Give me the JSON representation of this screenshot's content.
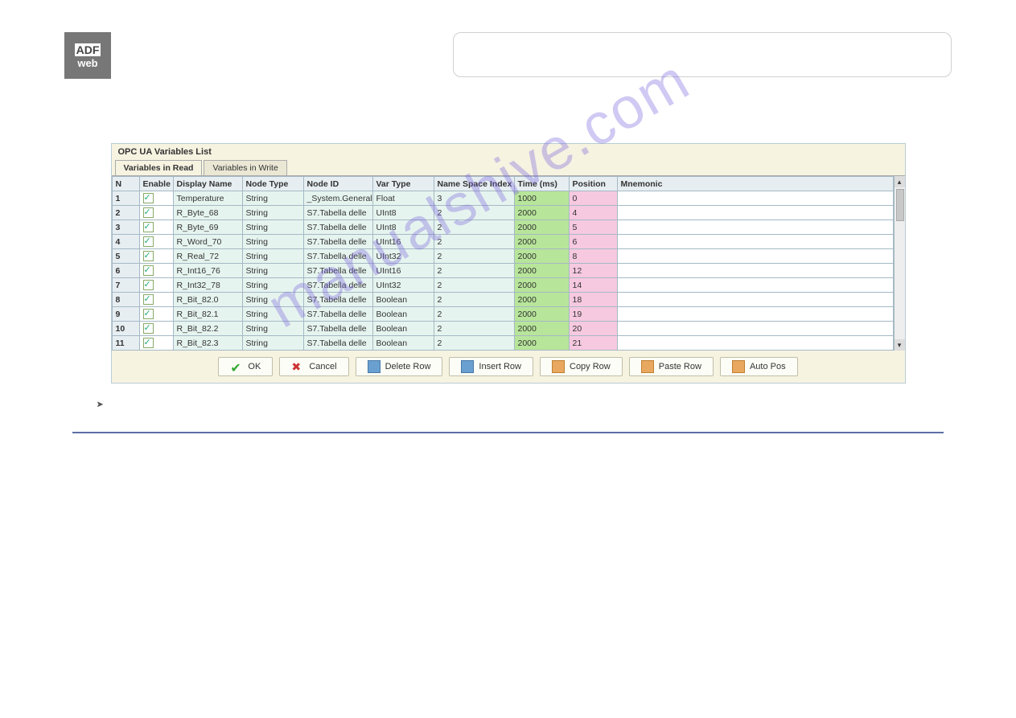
{
  "logo": {
    "line1": "ADF",
    "line2": "web"
  },
  "app": {
    "title": "OPC UA Variables List",
    "tabs": [
      "Variables in Read",
      "Variables in Write"
    ],
    "headers": [
      "N",
      "Enable",
      "Display Name",
      "Node Type",
      "Node ID",
      "Var Type",
      "Name Space Index",
      "Time (ms)",
      "Position",
      "Mnemonic"
    ],
    "rows": [
      {
        "n": "1",
        "dn": "Temperature",
        "nt": "String",
        "ni": "_System.General.T",
        "vt": "Float",
        "ns": "3",
        "tm": "1000",
        "po": "0",
        "mn": ""
      },
      {
        "n": "2",
        "dn": "R_Byte_68",
        "nt": "String",
        "ni": "S7.Tabella delle",
        "vt": "UInt8",
        "ns": "2",
        "tm": "2000",
        "po": "4",
        "mn": ""
      },
      {
        "n": "3",
        "dn": "R_Byte_69",
        "nt": "String",
        "ni": "S7.Tabella delle",
        "vt": "UInt8",
        "ns": "2",
        "tm": "2000",
        "po": "5",
        "mn": ""
      },
      {
        "n": "4",
        "dn": "R_Word_70",
        "nt": "String",
        "ni": "S7.Tabella delle",
        "vt": "UInt16",
        "ns": "2",
        "tm": "2000",
        "po": "6",
        "mn": ""
      },
      {
        "n": "5",
        "dn": "R_Real_72",
        "nt": "String",
        "ni": "S7.Tabella delle",
        "vt": "UInt32",
        "ns": "2",
        "tm": "2000",
        "po": "8",
        "mn": ""
      },
      {
        "n": "6",
        "dn": "R_Int16_76",
        "nt": "String",
        "ni": "S7.Tabella delle",
        "vt": "UInt16",
        "ns": "2",
        "tm": "2000",
        "po": "12",
        "mn": ""
      },
      {
        "n": "7",
        "dn": "R_Int32_78",
        "nt": "String",
        "ni": "S7.Tabella delle",
        "vt": "UInt32",
        "ns": "2",
        "tm": "2000",
        "po": "14",
        "mn": ""
      },
      {
        "n": "8",
        "dn": "R_Bit_82.0",
        "nt": "String",
        "ni": "S7.Tabella delle",
        "vt": "Boolean",
        "ns": "2",
        "tm": "2000",
        "po": "18",
        "mn": ""
      },
      {
        "n": "9",
        "dn": "R_Bit_82.1",
        "nt": "String",
        "ni": "S7.Tabella delle",
        "vt": "Boolean",
        "ns": "2",
        "tm": "2000",
        "po": "19",
        "mn": ""
      },
      {
        "n": "10",
        "dn": "R_Bit_82.2",
        "nt": "String",
        "ni": "S7.Tabella delle",
        "vt": "Boolean",
        "ns": "2",
        "tm": "2000",
        "po": "20",
        "mn": ""
      },
      {
        "n": "11",
        "dn": "R_Bit_82.3",
        "nt": "String",
        "ni": "S7.Tabella delle",
        "vt": "Boolean",
        "ns": "2",
        "tm": "2000",
        "po": "21",
        "mn": ""
      }
    ],
    "buttons": {
      "ok": "OK",
      "cancel": "Cancel",
      "delete": "Delete Row",
      "insert": "Insert Row",
      "copy": "Copy Row",
      "paste": "Paste Row",
      "auto": "Auto Pos"
    }
  },
  "watermark": "manualshive.com"
}
